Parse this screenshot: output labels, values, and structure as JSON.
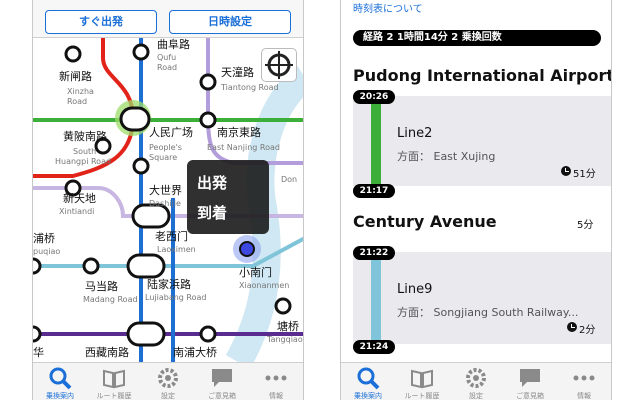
{
  "left": {
    "buttons": {
      "depart_now": "すぐ出発",
      "time_settings": "日時設定"
    },
    "stations": {
      "qufu_road": {
        "cn": "曲阜路",
        "en1": "Qufu",
        "en2": "Road"
      },
      "xinzha_road": {
        "cn": "新闸路",
        "en1": "Xinzha",
        "en2": "Road"
      },
      "tiantong_road": {
        "cn": "天潼路",
        "en1": "Tiantong Road"
      },
      "huangpi_road": {
        "cn": "黄陂南路",
        "en1": "South",
        "en2": "Huangpi Road"
      },
      "peoples_square": {
        "cn": "人民广场",
        "en1": "People's",
        "en2": "Square"
      },
      "nanjing_east": {
        "cn": "南京東路",
        "en1": "East Nanjing Road"
      },
      "xintiandi": {
        "cn": "新天地",
        "en1": "Xintiandi"
      },
      "dashijie": {
        "cn": "大世界",
        "en1": "Dashijie"
      },
      "laoximen": {
        "cn": "老西门",
        "en1": "Laoximen"
      },
      "xiaonanmen": {
        "cn": "小南门",
        "en1": "Xiaonanmen"
      },
      "puqiao": {
        "cn": "浦桥",
        "en1": "puqiao"
      },
      "madang_road": {
        "cn": "马当路",
        "en1": "Madang Road"
      },
      "lujiabang_road": {
        "cn": "陆家浜路",
        "en1": "Lujiabang Road"
      },
      "tangqiao": {
        "cn": "塘桥",
        "en1": "Tangqiao"
      },
      "xizang_road": {
        "cn": "西藏南路"
      },
      "nanpu_bridge": {
        "cn": "南浦大桥"
      },
      "dong": {
        "en1": "Don"
      },
      "partial_hua": {
        "cn": "华"
      }
    },
    "popup": {
      "depart": "出発",
      "arrive": "到着"
    }
  },
  "right": {
    "header_link": "時刻表について",
    "summary": "経路 2 1時間14分 2 乗換回数",
    "station1": "Pudong International Airport",
    "leg1": {
      "depart_time": "20:26",
      "line": "Line2",
      "direction": "方面： East Xujing",
      "duration": "51分",
      "arrive_time": "21:17",
      "color": "#3cae3a"
    },
    "station2": "Century Avenue",
    "transfer_time": "5分",
    "leg2": {
      "depart_time": "21:22",
      "line": "Line9",
      "direction": "方面： Songjiang South Railway...",
      "duration": "2分",
      "arrive_time": "21:24",
      "color": "#7fc4d8"
    }
  },
  "tabbar": [
    {
      "label": "乗換案内",
      "icon": "search-icon"
    },
    {
      "label": "ルート履歴",
      "icon": "book-icon"
    },
    {
      "label": "設定",
      "icon": "gear-icon"
    },
    {
      "label": "ご意見箱",
      "icon": "chat-icon"
    },
    {
      "label": "情報",
      "icon": "more-icon"
    }
  ],
  "colors": {
    "accent": "#1a6fd8",
    "line1": "#e2231a",
    "line2": "#3cae3a",
    "line8": "#4b1e8f",
    "line9": "#7fc4d8",
    "line10": "#b39ddb"
  }
}
